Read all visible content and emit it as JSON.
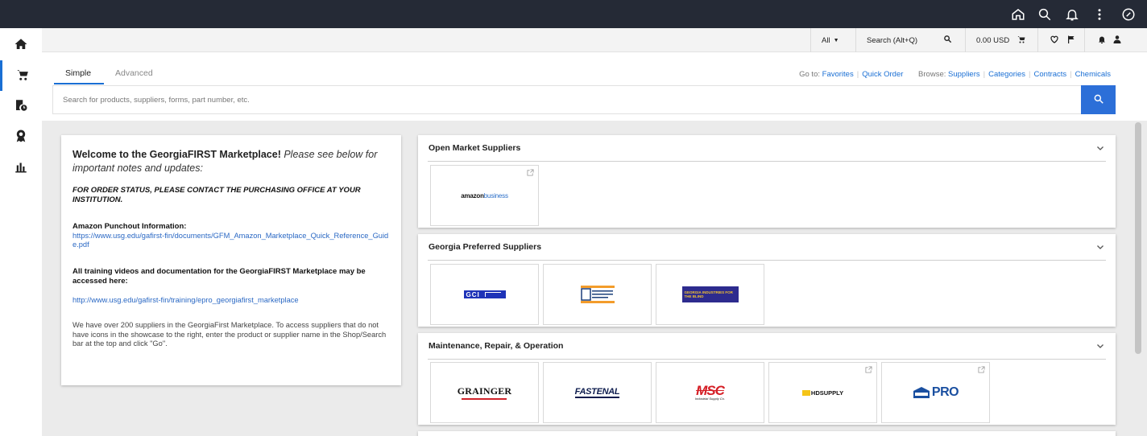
{
  "topbar": {
    "icons": [
      "home-outline-icon",
      "search-icon",
      "bell-icon",
      "more-vertical-icon",
      "compass-icon"
    ]
  },
  "sidebar": {
    "items": [
      {
        "icon": "home-icon"
      },
      {
        "icon": "cart-icon",
        "active": true
      },
      {
        "icon": "orders-history-icon"
      },
      {
        "icon": "award-icon"
      },
      {
        "icon": "analytics-icon"
      }
    ]
  },
  "utilbar": {
    "scope_label": "All",
    "search_label": "Search (Alt+Q)",
    "cart_total": "0.00 USD"
  },
  "search": {
    "tabs": [
      {
        "label": "Simple",
        "active": true
      },
      {
        "label": "Advanced",
        "active": false
      }
    ],
    "placeholder": "Search for products, suppliers, forms, part number, etc.",
    "goto_label": "Go to:",
    "goto_links": [
      "Favorites",
      "Quick Order"
    ],
    "browse_label": "Browse:",
    "browse_links": [
      "Suppliers",
      "Categories",
      "Contracts",
      "Chemicals"
    ]
  },
  "welcome": {
    "title_bold": "Welcome to the GeorgiaFIRST Marketplace!",
    "title_italic": "Please see below for important notes and updates:",
    "order_status": "FOR ORDER STATUS, PLEASE CONTACT THE PURCHASING OFFICE AT YOUR INSTITUTION.",
    "amazon_heading": "Amazon Punchout Information:",
    "amazon_link": "https://www.usg.edu/gafirst-fin/documents/GFM_Amazon_Marketplace_Quick_Reference_Guide.pdf",
    "training_heading": "All training videos and documentation for the GeorgiaFIRST Marketplace may be accessed here:",
    "training_link": "http://www.usg.edu/gafirst-fin/training/epro_georgiafirst_marketplace",
    "suppliers_note": "We have over 200 suppliers in the GeorgiaFirst Marketplace. To access suppliers that do not have icons in the showcase to the right, enter the product or supplier name in the Shop/Search bar at the top and click \"Go\"."
  },
  "showcases": [
    {
      "title": "Open Market Suppliers",
      "tiles": [
        {
          "logo": "amazonbusiness",
          "brand_text": "amazon",
          "sub_text": "business",
          "external": true
        }
      ]
    },
    {
      "title": "Georgia Preferred Suppliers",
      "tiles": [
        {
          "logo": "gci",
          "brand_text": "GCI",
          "external": false
        },
        {
          "logo": "georgia-correctional-industries",
          "brand_text": "",
          "external": false
        },
        {
          "logo": "georgia-industries-for-the-blind",
          "brand_text": "GEORGIA INDUSTRIES FOR THE BLIND",
          "external": false
        }
      ]
    },
    {
      "title": "Maintenance, Repair, & Operation",
      "tiles": [
        {
          "logo": "grainger",
          "brand_text": "GRAINGER",
          "external": false
        },
        {
          "logo": "fastenal",
          "brand_text": "FASTENAL",
          "external": false
        },
        {
          "logo": "msc",
          "brand_text": "MSC",
          "sub_text": "Industrial Supply Co.",
          "external": false
        },
        {
          "logo": "hd-supply",
          "brand_text": "HDSUPPLY",
          "external": true
        },
        {
          "logo": "lowes-pro",
          "brand_text": "PRO",
          "external": true
        }
      ]
    }
  ],
  "colors": {
    "topbar": "#252a36",
    "accent": "#1a6fd4",
    "search_button": "#2c6fd8",
    "background": "#ebebeb"
  }
}
